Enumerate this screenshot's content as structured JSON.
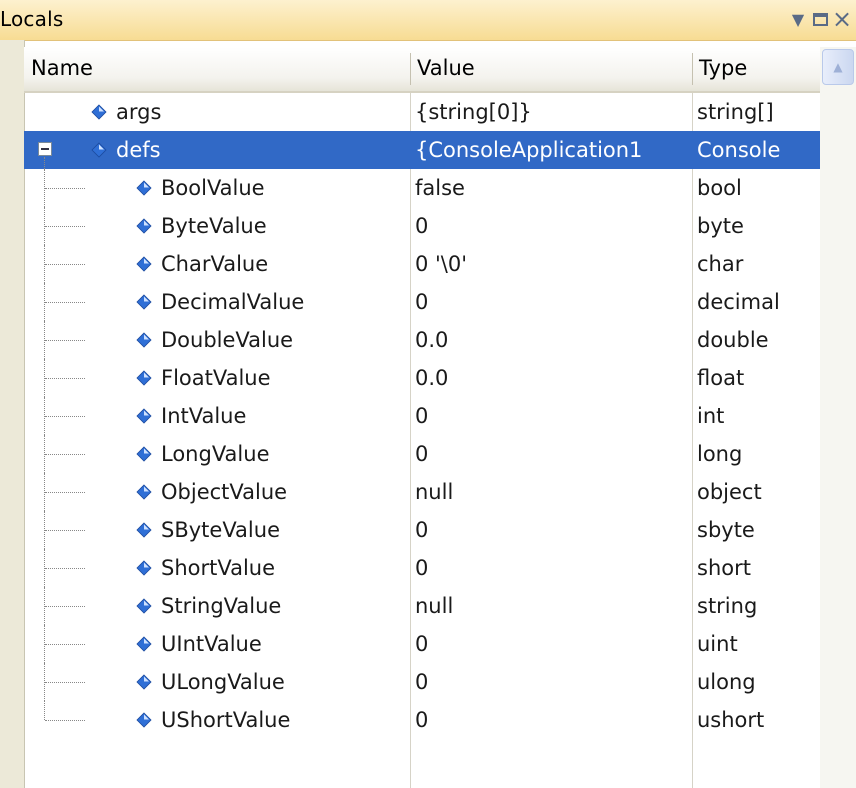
{
  "window": {
    "title": "Locals",
    "dropdown_glyph": "▼",
    "close_glyph": "×"
  },
  "columns": {
    "name": "Name",
    "value": "Value",
    "type": "Type"
  },
  "scroll_up_glyph": "▲",
  "rows": [
    {
      "name": "args",
      "value": "{string[0]}",
      "type": "string[]",
      "level": 0,
      "icon": "field-icon"
    },
    {
      "name": "defs",
      "value": "{ConsoleApplication1",
      "type": "Console",
      "level": 0,
      "icon": "field-icon",
      "expanded": true,
      "selected": true
    },
    {
      "name": "BoolValue",
      "value": "false",
      "type": "bool",
      "level": 1,
      "icon": "field-icon"
    },
    {
      "name": "ByteValue",
      "value": "0",
      "type": "byte",
      "level": 1,
      "icon": "field-icon"
    },
    {
      "name": "CharValue",
      "value": "0 '\\0'",
      "type": "char",
      "level": 1,
      "icon": "field-icon"
    },
    {
      "name": "DecimalValue",
      "value": "0",
      "type": "decimal",
      "level": 1,
      "icon": "field-icon"
    },
    {
      "name": "DoubleValue",
      "value": "0.0",
      "type": "double",
      "level": 1,
      "icon": "field-icon"
    },
    {
      "name": "FloatValue",
      "value": "0.0",
      "type": "float",
      "level": 1,
      "icon": "field-icon"
    },
    {
      "name": "IntValue",
      "value": "0",
      "type": "int",
      "level": 1,
      "icon": "field-icon"
    },
    {
      "name": "LongValue",
      "value": "0",
      "type": "long",
      "level": 1,
      "icon": "field-icon"
    },
    {
      "name": "ObjectValue",
      "value": "null",
      "type": "object",
      "level": 1,
      "icon": "field-icon"
    },
    {
      "name": "SByteValue",
      "value": "0",
      "type": "sbyte",
      "level": 1,
      "icon": "field-icon"
    },
    {
      "name": "ShortValue",
      "value": "0",
      "type": "short",
      "level": 1,
      "icon": "field-icon"
    },
    {
      "name": "StringValue",
      "value": "null",
      "type": "string",
      "level": 1,
      "icon": "field-icon"
    },
    {
      "name": "UIntValue",
      "value": "0",
      "type": "uint",
      "level": 1,
      "icon": "field-icon"
    },
    {
      "name": "ULongValue",
      "value": "0",
      "type": "ulong",
      "level": 1,
      "icon": "field-icon"
    },
    {
      "name": "UShortValue",
      "value": "0",
      "type": "ushort",
      "level": 1,
      "icon": "field-icon"
    }
  ],
  "colors": {
    "selection": "#3169c6",
    "titlebar_top": "#fdf1cf",
    "titlebar_bottom": "#f7dc93",
    "field_icon": "#2f6fd6"
  }
}
